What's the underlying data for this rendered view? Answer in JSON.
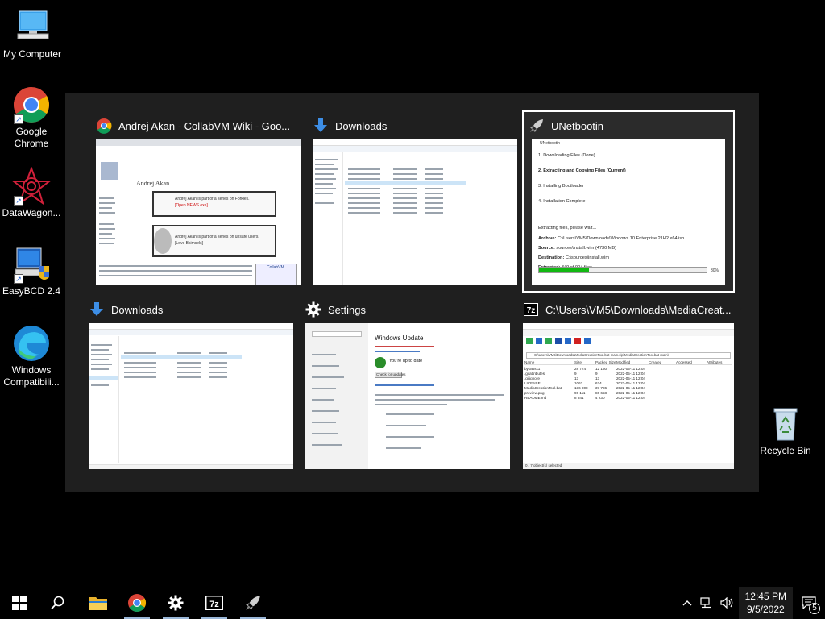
{
  "desktop": {
    "icons": [
      {
        "label": "My Computer"
      },
      {
        "label": "Google Chrome"
      },
      {
        "label": "DataWagon..."
      },
      {
        "label": "EasyBCD 2.4"
      },
      {
        "label": "Windows Compatibili..."
      },
      {
        "label": "Recycle Bin"
      }
    ]
  },
  "switcher": {
    "windows": [
      {
        "title": "Andrej Akan - CollabVM Wiki - Goo...",
        "icon": "chrome-icon"
      },
      {
        "title": "Downloads",
        "icon": "download-icon"
      },
      {
        "title": "UNetbootin",
        "icon": "rocket-icon",
        "selected": true
      },
      {
        "title": "Downloads",
        "icon": "download-icon"
      },
      {
        "title": "Settings",
        "icon": "gear-icon"
      },
      {
        "title": "C:\\Users\\VM5\\Downloads\\MediaCreat...",
        "icon": "7zip-icon"
      }
    ],
    "wiki": {
      "heading": "Andrej Akan",
      "box1": "Andrej Akan is part of a series on Forkies.",
      "box1_link": "[Open NEWS.exe]",
      "box2": "Andrej Akan is part of a series on unsafe users.",
      "box2_link": "[Love Bsimcels]",
      "side_title": "CollabVM"
    },
    "unetbootin": {
      "window_title": "UNetbootin",
      "steps": [
        "1. Downloading Files (Done)",
        "2. Extracting and Copying Files (Current)",
        "3. Installing Bootloader",
        "4. Installation Complete"
      ],
      "status": "Extracting files, please wait...",
      "archive_label": "Archive:",
      "archive": "C:\\Users\\VM5\\Downloads\\Windows 10 Enterprise 21H2 x64.iso",
      "source_label": "Source:",
      "source": "sources\\install.wim (4730 MB)",
      "dest_label": "Destination:",
      "dest": "C:\\sources\\install.wim",
      "extracted_label": "Extracted:",
      "extracted": "349 of 904 files",
      "progress_percent": 30,
      "progress_text": "30%"
    },
    "settings": {
      "section": "Windows Update",
      "status": "You're up to date",
      "check": "Check for updates"
    },
    "sevenzip": {
      "path": "C:\\Users\\VM5\\Downloads\\MediaCreationTool.bat-main.zip\\MediaCreationTool.bat-main\\",
      "columns": [
        "Name",
        "Size",
        "Packed Size",
        "Modified",
        "Created",
        "Accessed",
        "Attributes"
      ],
      "rows": [
        [
          "bypass11",
          "28 774",
          "12 160",
          "2022-05-11 12:04"
        ],
        [
          ".gitattributes",
          "9",
          "9",
          "2022-05-11 12:04"
        ],
        [
          ".gitignore",
          "13",
          "13",
          "2022-05-11 12:04"
        ],
        [
          "LICENSE",
          "1062",
          "624",
          "2022-05-11 12:04"
        ],
        [
          "MediaCreationTool.bat",
          "136 908",
          "37 786",
          "2022-05-11 12:04"
        ],
        [
          "preview.png",
          "90 111",
          "86 658",
          "2022-05-11 12:04"
        ],
        [
          "README.md",
          "8 841",
          "4 230",
          "2022-05-11 12:04"
        ]
      ],
      "statusbar": "0 / 7 object(s) selected"
    }
  },
  "taskbar": {
    "apps": [
      "file-explorer-icon",
      "chrome-icon",
      "settings-icon",
      "7zip-icon",
      "unetbootin-icon"
    ],
    "time": "12:45 PM",
    "date": "9/5/2022",
    "notifications": "5"
  }
}
